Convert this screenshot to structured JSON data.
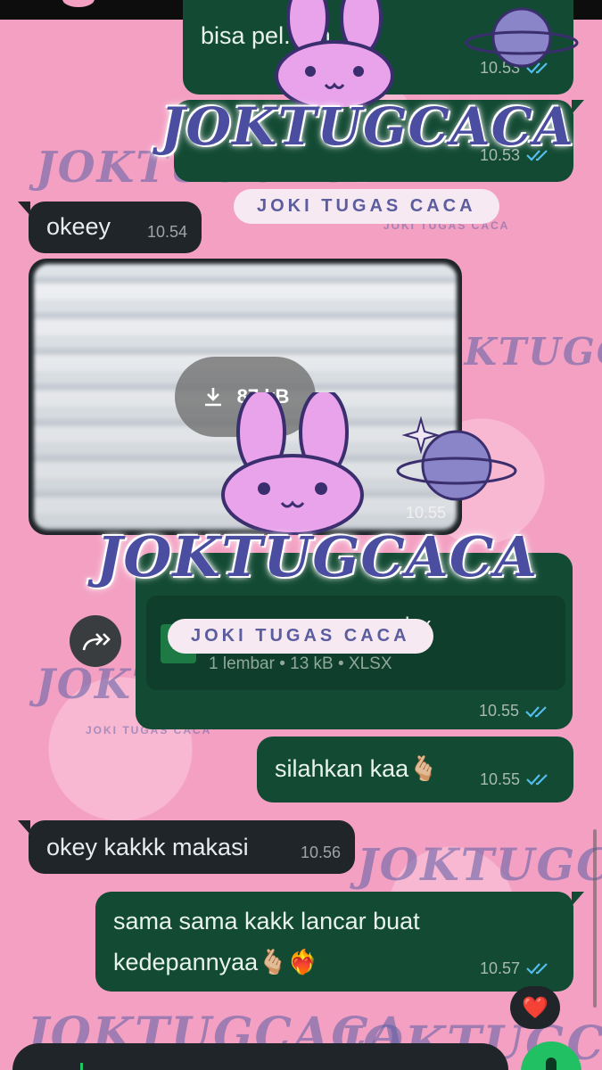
{
  "watermark": {
    "brand": "JOKTUGCACA",
    "tagline": "JOKI TUGAS CACA"
  },
  "messages": [
    {
      "id": "m1",
      "direction": "out",
      "text": "bisa pel...nh",
      "time": "10.53",
      "status": "read"
    },
    {
      "id": "m2",
      "direction": "out",
      "text": "",
      "time": "10.53",
      "status": "read"
    },
    {
      "id": "m3",
      "direction": "in",
      "text": "okeey",
      "time": "10.54"
    },
    {
      "id": "m4",
      "direction": "in",
      "type": "media",
      "download_size": "87 kB",
      "time": "10.55"
    },
    {
      "id": "m5",
      "direction": "out",
      "type": "document",
      "filename": "...lsx",
      "details": "1 lembar • 13 kB • XLSX",
      "time": "10.55",
      "status": "read"
    },
    {
      "id": "m6",
      "direction": "out",
      "text": "silahkan kaa🫰🏼",
      "time": "10.55",
      "status": "read"
    },
    {
      "id": "m7",
      "direction": "in",
      "text": "okey kakkk makasi",
      "time": "10.56"
    },
    {
      "id": "m8",
      "direction": "out",
      "text": "sama sama kakk lancar buat kedepannyaa🫰🏼❤️‍🔥",
      "time": "10.57",
      "status": "read"
    }
  ],
  "reaction": "❤️",
  "icons": {
    "download": "download-icon",
    "forward": "forward-icon",
    "ticks": "double-check-icon",
    "file": "xlsx-file-icon",
    "mic": "mic-icon"
  },
  "colors": {
    "outgoing_bubble": "#124a33",
    "incoming_bubble": "#1f2528",
    "read_ticks": "#53bdeb",
    "wallpaper": "#f3a0c2",
    "accent": "#21c063"
  }
}
